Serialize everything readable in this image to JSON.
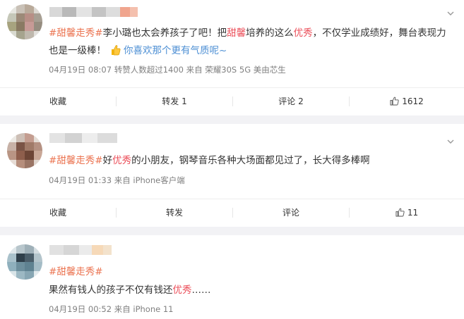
{
  "posts": [
    {
      "parts": [
        {
          "t": "#甜馨走秀#",
          "c": "tag"
        },
        {
          "t": "李小璐也太会养孩子了吧！把",
          "c": ""
        },
        {
          "t": "甜馨",
          "c": "hl"
        },
        {
          "t": "培养的这么",
          "c": ""
        },
        {
          "t": "优秀",
          "c": "hl"
        },
        {
          "t": "，不仅学业成绩好，舞台表现力",
          "c": ""
        }
      ],
      "line2_text": "也是一级棒！",
      "line2_link": "你喜欢那个更有气质呢~",
      "meta": "04月19日 08:07  转赞人数超过1400   来自 荣耀30S 5G 美由芯生",
      "actions": {
        "fav": "收藏",
        "share": "转发 1",
        "comment": "评论 2",
        "like": "1612"
      }
    },
    {
      "parts": [
        {
          "t": "#甜馨走秀#",
          "c": "tag"
        },
        {
          "t": "好",
          "c": ""
        },
        {
          "t": "优秀",
          "c": "hl"
        },
        {
          "t": "的小朋友，钢琴音乐各种大场面都见过了，长大得多棒啊",
          "c": ""
        }
      ],
      "meta": "04月19日 01:33  来自 iPhone客户端",
      "actions": {
        "fav": "收藏",
        "share": "转发",
        "comment": "评论",
        "like": "11"
      }
    },
    {
      "tag_line": "#甜馨走秀#",
      "parts": [
        {
          "t": "果然有钱人的孩子不仅有钱还",
          "c": ""
        },
        {
          "t": "优秀",
          "c": "hl"
        },
        {
          "t": "……",
          "c": ""
        }
      ],
      "meta": "04月19日 00:52  来自 iPhone 11"
    }
  ],
  "icons": {
    "more": "chevron-down-icon",
    "like": "thumbs-up-icon",
    "emoji": "thumbs-up-emoji-icon"
  },
  "colors": {
    "topic": "#eb7350",
    "keyword": "#eb4f5a",
    "link": "#4d8fd4",
    "meta": "#808080"
  }
}
